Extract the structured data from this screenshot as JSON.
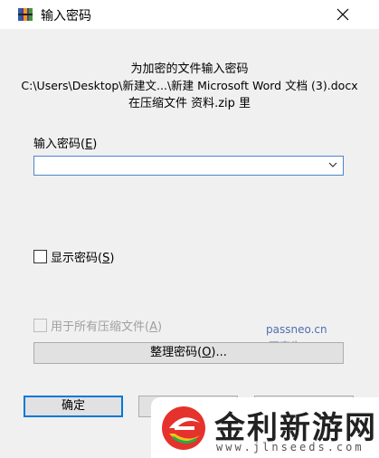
{
  "window": {
    "title": "输入密码",
    "icon": "winrar-archive-icon"
  },
  "info": {
    "line1": "为加密的文件输入密码",
    "line2": "C:\\Users\\Desktop\\新建文...\\新建 Microsoft Word 文档 (3).docx",
    "line3": "在压缩文件 资料.zip 里"
  },
  "password": {
    "label": "输入密码(",
    "label_key": "E",
    "label_end": ")",
    "value": ""
  },
  "show_password": {
    "label": "显示密码(",
    "key": "S",
    "label_end": ")",
    "checked": false
  },
  "use_for_all": {
    "label": "用于所有压缩文件(",
    "key": "A",
    "label_end": ")",
    "checked": false,
    "enabled": false
  },
  "organize_button": {
    "label": "整理密码(",
    "key": "O",
    "label_end": ")..."
  },
  "buttons": {
    "ok": "确定"
  },
  "watermark": {
    "line1": "passneo.cn",
    "line2": "百事牛"
  },
  "badge": {
    "name": "金利新游网",
    "url": "www.jlnseeds.com"
  },
  "colors": {
    "focus_border": "#0078d7",
    "watermark": "#4e6fb0"
  }
}
